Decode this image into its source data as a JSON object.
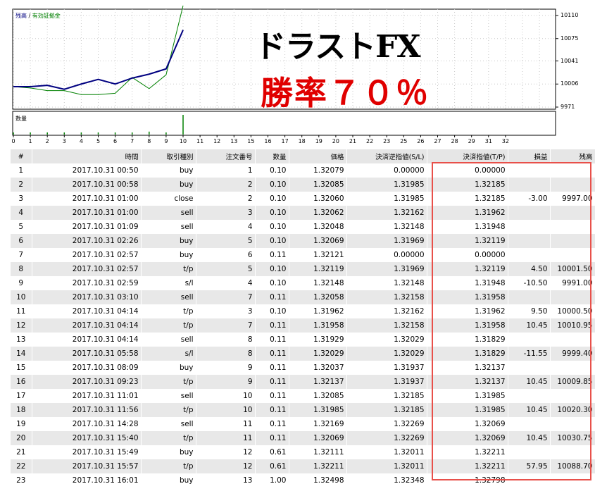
{
  "chart": {
    "legend_balance": "残高",
    "legend_sep": "/",
    "legend_equity": "有効証拠金",
    "volume_label": "数量",
    "y_ticks": [
      "10110",
      "10075",
      "10041",
      "10006",
      "9971"
    ],
    "x_ticks": [
      "0",
      "1",
      "2",
      "3",
      "4",
      "5",
      "6",
      "7",
      "8",
      "9",
      "10",
      "11",
      "12",
      "13",
      "15",
      "16",
      "17",
      "18",
      "19",
      "20",
      "21",
      "22",
      "23",
      "25",
      "26",
      "27",
      "28",
      "29",
      "31",
      "32"
    ],
    "balance_color": "#000080",
    "equity_color": "#008000",
    "headline": "ドラストFX",
    "subline": "勝率７０％",
    "subline_color": "#e00000"
  },
  "chart_data": {
    "type": "line",
    "x": [
      0,
      1,
      2,
      3,
      4,
      5,
      6,
      7,
      8,
      9,
      10
    ],
    "series": [
      {
        "name": "残高",
        "values": [
          10002,
          10002,
          10004,
          9998,
          10006,
          10013,
          10006,
          10015,
          10021,
          10029,
          10088
        ]
      },
      {
        "name": "有効証拠金",
        "values": [
          10002,
          10000,
          9996,
          9996,
          9990,
          9990,
          9992,
          10016,
          9999,
          10020,
          10125
        ]
      }
    ],
    "volume_values": [
      0.1,
      0.1,
      0.1,
      0.1,
      0.1,
      0.1,
      0.1,
      0.2,
      0.3,
      0.1,
      2.0
    ],
    "ylim": [
      9971,
      10110
    ]
  },
  "table": {
    "headers": [
      "#",
      "時間",
      "取引種別",
      "注文番号",
      "数量",
      "価格",
      "決済逆指値(S/L)",
      "決済指値(T/P)",
      "損益",
      "残高"
    ],
    "rows": [
      [
        "1",
        "2017.10.31 00:50",
        "buy",
        "1",
        "0.10",
        "1.32079",
        "0.00000",
        "0.00000",
        "",
        ""
      ],
      [
        "2",
        "2017.10.31 00:58",
        "buy",
        "2",
        "0.10",
        "1.32085",
        "1.31985",
        "1.32185",
        "",
        ""
      ],
      [
        "3",
        "2017.10.31 01:00",
        "close",
        "2",
        "0.10",
        "1.32060",
        "1.31985",
        "1.32185",
        "-3.00",
        "9997.00"
      ],
      [
        "4",
        "2017.10.31 01:00",
        "sell",
        "3",
        "0.10",
        "1.32062",
        "1.32162",
        "1.31962",
        "",
        ""
      ],
      [
        "5",
        "2017.10.31 01:09",
        "sell",
        "4",
        "0.10",
        "1.32048",
        "1.32148",
        "1.31948",
        "",
        ""
      ],
      [
        "6",
        "2017.10.31 02:26",
        "buy",
        "5",
        "0.10",
        "1.32069",
        "1.31969",
        "1.32119",
        "",
        ""
      ],
      [
        "7",
        "2017.10.31 02:57",
        "buy",
        "6",
        "0.11",
        "1.32121",
        "0.00000",
        "0.00000",
        "",
        ""
      ],
      [
        "8",
        "2017.10.31 02:57",
        "t/p",
        "5",
        "0.10",
        "1.32119",
        "1.31969",
        "1.32119",
        "4.50",
        "10001.50"
      ],
      [
        "9",
        "2017.10.31 02:59",
        "s/l",
        "4",
        "0.10",
        "1.32148",
        "1.32148",
        "1.31948",
        "-10.50",
        "9991.00"
      ],
      [
        "10",
        "2017.10.31 03:10",
        "sell",
        "7",
        "0.11",
        "1.32058",
        "1.32158",
        "1.31958",
        "",
        ""
      ],
      [
        "11",
        "2017.10.31 04:14",
        "t/p",
        "3",
        "0.10",
        "1.31962",
        "1.32162",
        "1.31962",
        "9.50",
        "10000.50"
      ],
      [
        "12",
        "2017.10.31 04:14",
        "t/p",
        "7",
        "0.11",
        "1.31958",
        "1.32158",
        "1.31958",
        "10.45",
        "10010.95"
      ],
      [
        "13",
        "2017.10.31 04:14",
        "sell",
        "8",
        "0.11",
        "1.31929",
        "1.32029",
        "1.31829",
        "",
        ""
      ],
      [
        "14",
        "2017.10.31 05:58",
        "s/l",
        "8",
        "0.11",
        "1.32029",
        "1.32029",
        "1.31829",
        "-11.55",
        "9999.40"
      ],
      [
        "15",
        "2017.10.31 08:09",
        "buy",
        "9",
        "0.11",
        "1.32037",
        "1.31937",
        "1.32137",
        "",
        ""
      ],
      [
        "16",
        "2017.10.31 09:23",
        "t/p",
        "9",
        "0.11",
        "1.32137",
        "1.31937",
        "1.32137",
        "10.45",
        "10009.85"
      ],
      [
        "17",
        "2017.10.31 11:01",
        "sell",
        "10",
        "0.11",
        "1.32085",
        "1.32185",
        "1.31985",
        "",
        ""
      ],
      [
        "18",
        "2017.10.31 11:56",
        "t/p",
        "10",
        "0.11",
        "1.31985",
        "1.32185",
        "1.31985",
        "10.45",
        "10020.30"
      ],
      [
        "19",
        "2017.10.31 14:28",
        "sell",
        "11",
        "0.11",
        "1.32169",
        "1.32269",
        "1.32069",
        "",
        ""
      ],
      [
        "20",
        "2017.10.31 15:40",
        "t/p",
        "11",
        "0.11",
        "1.32069",
        "1.32269",
        "1.32069",
        "10.45",
        "10030.75"
      ],
      [
        "21",
        "2017.10.31 15:49",
        "buy",
        "12",
        "0.61",
        "1.32111",
        "1.32011",
        "1.32211",
        "",
        ""
      ],
      [
        "22",
        "2017.10.31 15:57",
        "t/p",
        "12",
        "0.61",
        "1.32211",
        "1.32011",
        "1.32211",
        "57.95",
        "10088.70"
      ],
      [
        "23",
        "2017.10.31 16:01",
        "buy",
        "13",
        "1.00",
        "1.32498",
        "1.32348",
        "1.32798",
        "",
        ""
      ]
    ],
    "highlight_color": "#e8504a"
  }
}
